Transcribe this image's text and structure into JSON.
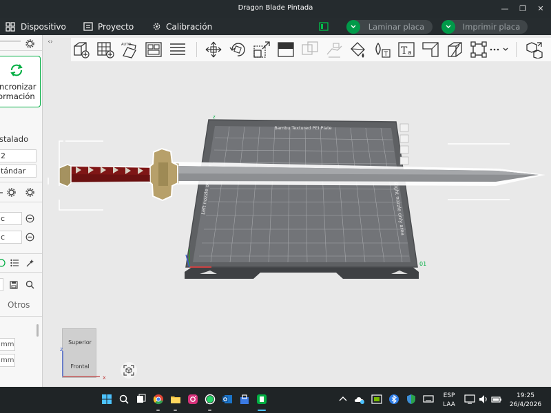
{
  "window": {
    "title": "Dragon Blade Pintada",
    "minimize_glyph": "—",
    "restore_glyph": "❐",
    "close_glyph": "✕"
  },
  "menu": {
    "dispositivo": "Dispositivo",
    "proyecto": "Proyecto",
    "calibracion": "Calibración",
    "laminar": "Laminar placa",
    "imprimir": "Imprimir placa"
  },
  "left_panel": {
    "sync_line1": "ncronizar",
    "sync_line2": "formación",
    "instalado": "stalado",
    "field_2": "2",
    "field_estandar": "tándar",
    "field_c1": "c",
    "field_c2": "c",
    "otros": "Otros",
    "mm1": "mm",
    "mm2": "mm"
  },
  "viewport": {
    "plate_title": "Bambu Textured PEI Plate",
    "left_nozzle": "Left nozzle only area",
    "right_nozzle": "Right nozzle only area",
    "plate_number": "01",
    "axis_x": "x",
    "axis_y": "y",
    "axis_z": "z",
    "view_top": "Superior",
    "view_front": "Frontal"
  },
  "taskbar": {
    "lang1": "ESP",
    "lang2": "LAA",
    "time": "19:25",
    "date": "26/4/2026"
  },
  "colors": {
    "accent_green": "#00ae42",
    "titlebar": "#252b2e",
    "plate": "#5e6063",
    "blade": "#8a8a8a",
    "handle": "#8b1a1a",
    "guard": "#b7a06a"
  }
}
